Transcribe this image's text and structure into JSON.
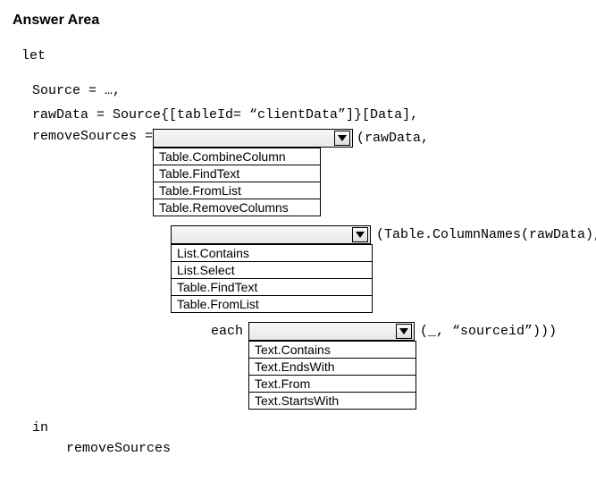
{
  "title": "Answer Area",
  "code": {
    "let": "let",
    "source_line": "Source = …,",
    "rawdata_line": "rawData = Source{[tableId= “clientData”]}[Data],",
    "remove_prefix": "removeSources = ",
    "after1": "(rawData,",
    "after2": "(Table.ColumnNames(rawData),",
    "each": "each",
    "after3": "(_, “sourceid”)))",
    "in": "in",
    "ret": "removeSources"
  },
  "dropdown1": {
    "width_head": 224,
    "width_list": 186,
    "options": [
      "Table.CombineColumn",
      "Table.FindText",
      "Table.FromList",
      "Table.RemoveColumns"
    ]
  },
  "dropdown2": {
    "width_head": 224,
    "width_list": 224,
    "options": [
      "List.Contains",
      "List.Select",
      "Table.FindText",
      "Table.FromList"
    ]
  },
  "dropdown3": {
    "width_head": 186,
    "width_list": 186,
    "options": [
      "Text.Contains",
      "Text.EndsWith",
      "Text.From",
      "Text.StartsWith"
    ]
  }
}
